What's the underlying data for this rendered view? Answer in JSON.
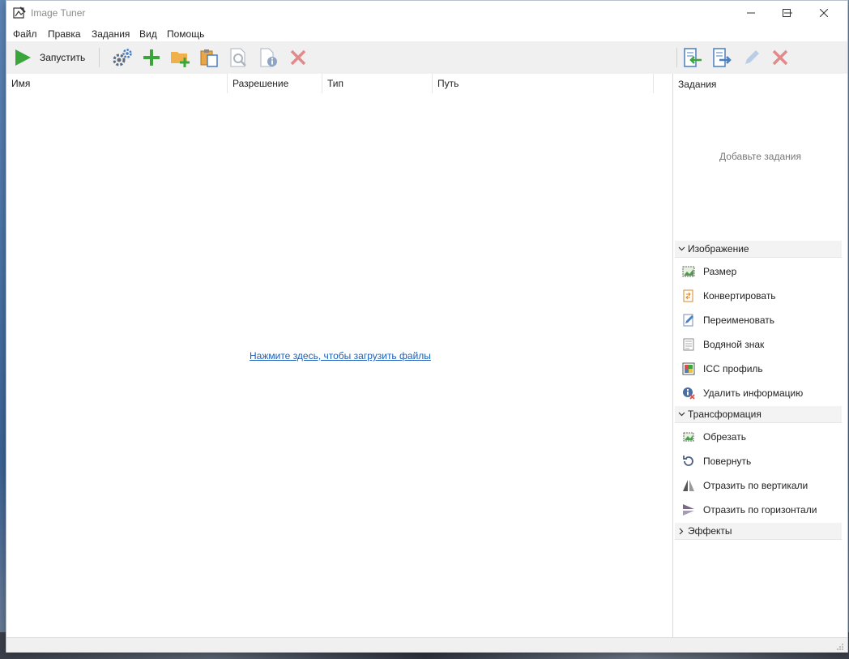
{
  "window": {
    "title": "Image Tuner"
  },
  "menu": [
    "Файл",
    "Правка",
    "Задания",
    "Вид",
    "Помощь"
  ],
  "toolbar": {
    "run_label": "Запустить",
    "icons": [
      "settings-icon",
      "add-files-icon",
      "add-folder-icon",
      "paste-icon",
      "preview-icon",
      "file-info-icon",
      "remove-icon"
    ],
    "right_icons": [
      "import-tasks-icon",
      "export-tasks-icon",
      "edit-task-icon",
      "delete-task-icon"
    ]
  },
  "list": {
    "columns": [
      "Имя",
      "Разрешение",
      "Тип",
      "Путь"
    ],
    "empty_link": "Нажмите здесь, чтобы загрузить файлы"
  },
  "tasks": {
    "header": "Задания",
    "empty_text": "Добавьте задания"
  },
  "groups": [
    {
      "label": "Изображение",
      "expanded": true,
      "items": [
        {
          "label": "Размер",
          "icon": "resize-icon"
        },
        {
          "label": "Конвертировать",
          "icon": "convert-icon"
        },
        {
          "label": "Переименовать",
          "icon": "rename-icon"
        },
        {
          "label": "Водяной знак",
          "icon": "watermark-icon"
        },
        {
          "label": "ICC профиль",
          "icon": "icc-profile-icon"
        },
        {
          "label": "Удалить информацию",
          "icon": "remove-info-icon"
        }
      ]
    },
    {
      "label": "Трансформация",
      "expanded": true,
      "items": [
        {
          "label": "Обрезать",
          "icon": "crop-icon"
        },
        {
          "label": "Повернуть",
          "icon": "rotate-icon"
        },
        {
          "label": "Отразить по вертикали",
          "icon": "flip-vertical-icon"
        },
        {
          "label": "Отразить по горизонтали",
          "icon": "flip-horizontal-icon"
        }
      ]
    },
    {
      "label": "Эффекты",
      "expanded": false,
      "items": []
    }
  ],
  "colors": {
    "run_green": "#3aa53a",
    "remove_red": "#d9534f",
    "link_blue": "#1d5fb8"
  }
}
